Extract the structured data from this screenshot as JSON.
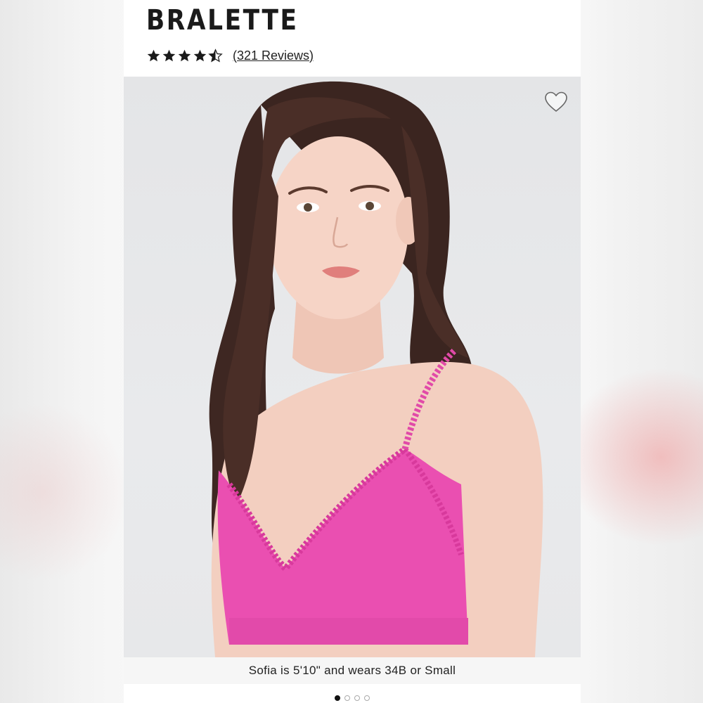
{
  "product": {
    "title": "BRALETTE",
    "rating_value": 4.5,
    "rating_max": 5,
    "reviews_label": "(321 Reviews)"
  },
  "gallery": {
    "caption": "Sofia is 5'10\" and wears 34B or Small",
    "image_count": 4,
    "active_index": 0,
    "favorite_icon": "heart-outline-icon"
  },
  "colors": {
    "accent_pink": "#ea4fb1",
    "text": "#1a1a1a"
  }
}
